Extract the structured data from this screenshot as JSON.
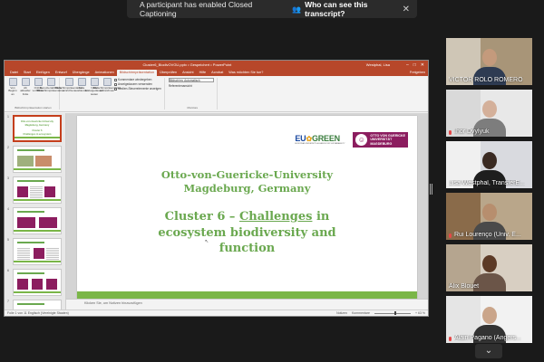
{
  "notice": {
    "text": "A participant has enabled Closed Captioning",
    "link": "Who can see this transcript?",
    "close": "✕"
  },
  "ppt": {
    "window_title": "Cluster6_BiodivOVGU.pptx  •  Gespeichert  •  PowerPoint",
    "user": "Westphal, Lisa",
    "tabs": [
      "Datei",
      "Start",
      "Einfügen",
      "Entwurf",
      "Übergänge",
      "Animationen",
      "Bildschirmpräsentation",
      "Überprüfen",
      "Ansicht",
      "Hilfe",
      "Acrobat",
      "Was möchten Sie tun?"
    ],
    "share": "Freigeben",
    "ribbon": {
      "group1_buttons": [
        "Von Beginn an",
        "Ab aktueller Folie",
        "Online vorführen",
        "Benutzerdefinierte Bildschirmpräsentation"
      ],
      "group1_label": "Bildschirmpräsentation starten",
      "group2_buttons": [
        "Bildschirmpräsentation einrichten",
        "Folie ausblenden",
        "Neue Anzeigedauern testen",
        "Bildschirmpräsentation aufzeichnen"
      ],
      "checks": [
        "Kommentare wiedergeben",
        "Anzeigedauern verwenden",
        "Medien-Steuerelemente anzeigen"
      ],
      "monitor_label": "Bildschirm: Automatisch",
      "presenter_label": "Referentenansicht",
      "group3_label": "Monitore"
    },
    "slide_numbers": [
      "1",
      "2",
      "3",
      "4",
      "5",
      "6",
      "7"
    ],
    "thumb1_lines": [
      "Otto-von-Guericke-University",
      "Magdeburg, Germany",
      "Cluster 6",
      "Challenges in ecosystem"
    ],
    "notes_placeholder": "Klicken Sie, um Notizen hinzuzufügen",
    "status_left": "Folie 1 von 11   Englisch (Vereinigte Staaten)",
    "status_right": [
      "Notizen",
      "Kommentare",
      "+ 63 %"
    ]
  },
  "slide": {
    "eu_logo_text": "EU",
    "eu_logo_green": "GREEN",
    "eu_sub": "EUROPEAN UNIVERSITY ALLIANCE FOR SUSTAINABILITY",
    "ovgu_text": [
      "OTTO VON GUERICKE",
      "UNIVERSITÄT",
      "MAGDEBURG"
    ],
    "university_line1": "Otto-von-Guericke-University",
    "university_line2": "Magdeburg, Germany",
    "cluster_prefix": "Cluster 6 – ",
    "cluster_underlined": "Challenges",
    "cluster_suffix": " in",
    "cluster_line2": "ecosystem biodiversity and",
    "cluster_line3": "function"
  },
  "participants": [
    {
      "name": "VICTOR ROLO ROMERO"
    },
    {
      "name": "Ihor Dvylyuk"
    },
    {
      "name": "Lisa Westphal, TransferE..."
    },
    {
      "name": "Rui Lourenço (Univ. E..."
    },
    {
      "name": "Alix Blouet"
    },
    {
      "name": "Alain Pagano (Angers..."
    }
  ],
  "colors": {
    "ppt_accent": "#b7472a",
    "slide_green": "#6aa84f",
    "ovgu_purple": "#8c1d5f",
    "active_speaker": "#f2d34b"
  }
}
